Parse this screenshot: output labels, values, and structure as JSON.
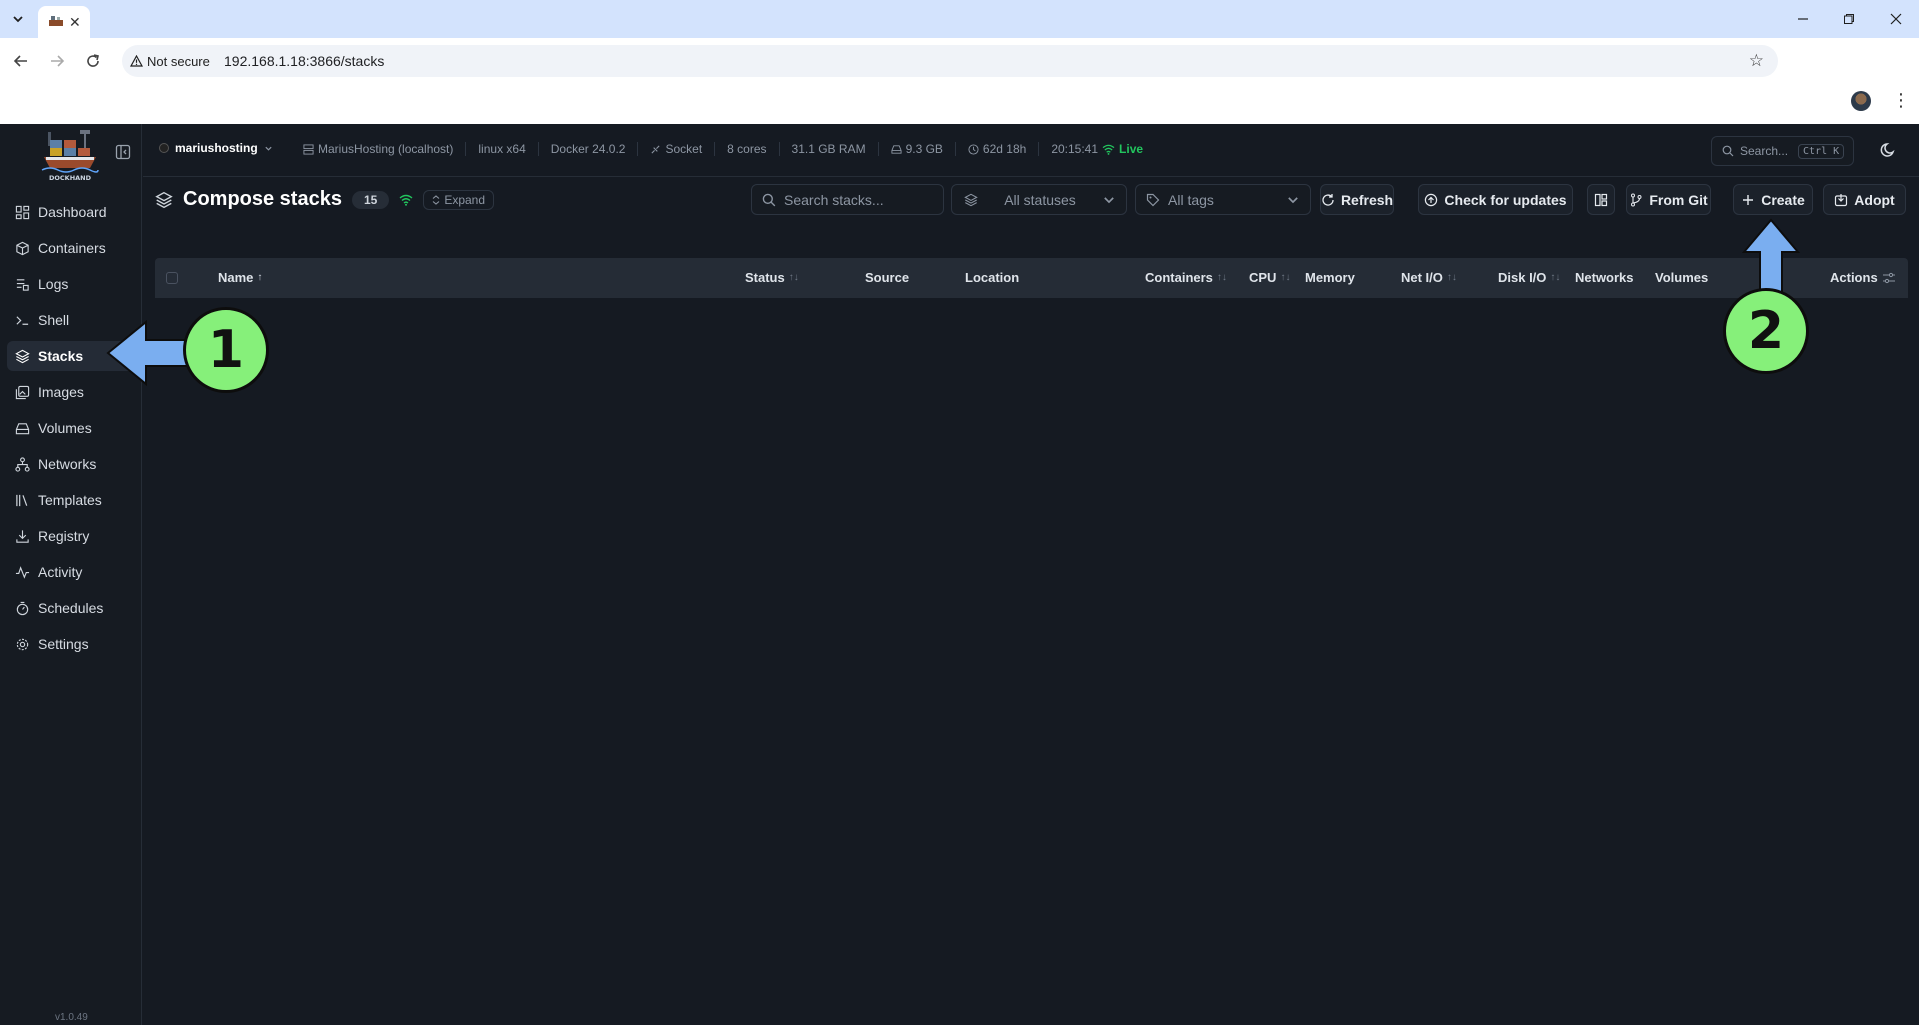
{
  "browser": {
    "url": "192.168.1.18:3866/stacks",
    "security_label": "Not secure"
  },
  "app": {
    "brand": "DOCKHAND",
    "version": "v1.0.49"
  },
  "sidebar": {
    "items": [
      {
        "label": "Dashboard",
        "icon": "dashboard-icon"
      },
      {
        "label": "Containers",
        "icon": "box-icon"
      },
      {
        "label": "Logs",
        "icon": "logs-icon"
      },
      {
        "label": "Shell",
        "icon": "terminal-icon"
      },
      {
        "label": "Stacks",
        "icon": "layers-icon",
        "active": true
      },
      {
        "label": "Images",
        "icon": "images-icon"
      },
      {
        "label": "Volumes",
        "icon": "hard-drive-icon"
      },
      {
        "label": "Networks",
        "icon": "network-icon"
      },
      {
        "label": "Templates",
        "icon": "library-icon"
      },
      {
        "label": "Registry",
        "icon": "download-icon"
      },
      {
        "label": "Activity",
        "icon": "activity-icon"
      },
      {
        "label": "Schedules",
        "icon": "timer-icon"
      },
      {
        "label": "Settings",
        "icon": "gear-icon"
      }
    ]
  },
  "topbar": {
    "environment": "mariushosting",
    "host": "MariusHosting (localhost)",
    "platform": "linux x64",
    "docker": "Docker 24.0.2",
    "connection": "Socket",
    "cores": "8 cores",
    "ram": "31.1 GB RAM",
    "disk": "9.3 GB",
    "uptime": "62d 18h",
    "time": "20:15:41",
    "live": "Live",
    "search_placeholder": "Search...",
    "search_shortcut": "Ctrl K"
  },
  "page": {
    "title": "Compose stacks",
    "count": "15",
    "expand_label": "Expand",
    "search_placeholder": "Search stacks...",
    "status_filter": "All statuses",
    "tags_filter": "All tags",
    "buttons": {
      "refresh": "Refresh",
      "check_updates": "Check for updates",
      "from_git": "From Git",
      "create": "Create",
      "adopt": "Adopt"
    }
  },
  "table": {
    "columns": [
      "Name",
      "Status",
      "Source",
      "Location",
      "Containers",
      "CPU",
      "Memory",
      "Net I/O",
      "Disk I/O",
      "Networks",
      "Volumes",
      "Actions"
    ]
  },
  "annotations": {
    "step1": "1",
    "step2": "2"
  },
  "colors": {
    "accent_green": "#22c55e",
    "annotation_green": "#86f07a",
    "annotation_arrow": "#7aaef0",
    "background": "#151a22"
  }
}
